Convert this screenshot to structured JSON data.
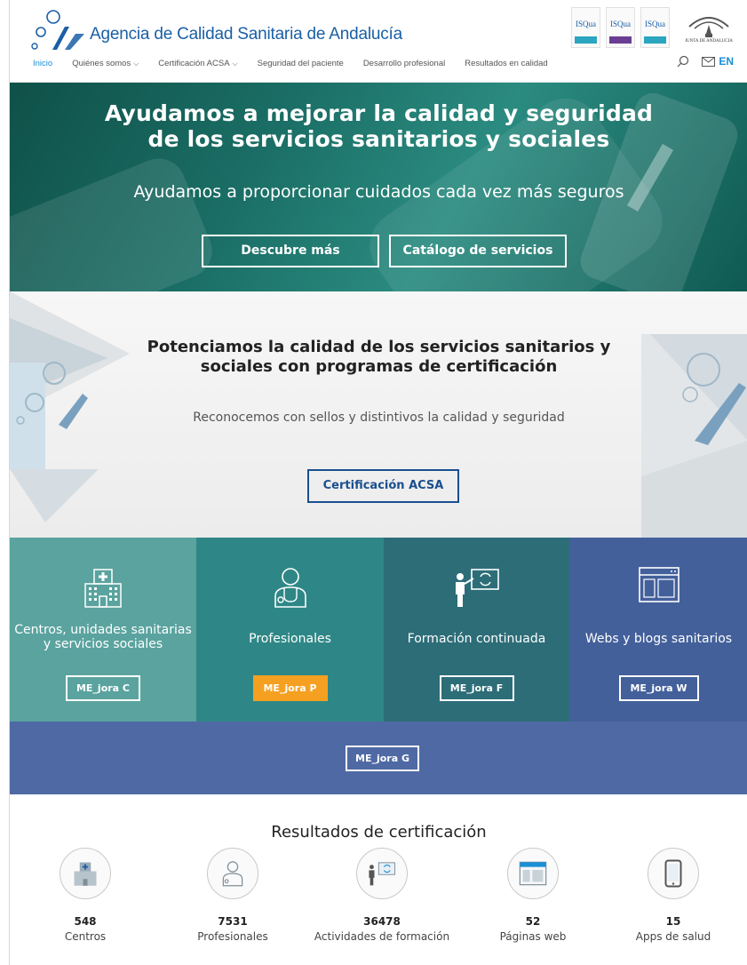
{
  "header": {
    "agency_name": "Agencia de Calidad Sanitaria de Andalucía",
    "badges": [
      {
        "text": "ISQua",
        "color": "#2aa6c0"
      },
      {
        "text": "ISQua",
        "color": "#6a3e93"
      },
      {
        "text": "ISQua",
        "color": "#2aa6c0"
      }
    ],
    "junta_text": "JUNTA DE ANDALUCIA"
  },
  "nav": {
    "items": [
      {
        "label": "Inicio",
        "active": true,
        "dropdown": false
      },
      {
        "label": "Quiénes somos",
        "active": false,
        "dropdown": true
      },
      {
        "label": "Certificación ACSA",
        "active": false,
        "dropdown": true
      },
      {
        "label": "Seguridad del paciente",
        "active": false,
        "dropdown": false
      },
      {
        "label": "Desarrollo profesional",
        "active": false,
        "dropdown": false
      },
      {
        "label": "Resultados en calidad",
        "active": false,
        "dropdown": false
      }
    ],
    "lang": "EN"
  },
  "hero": {
    "title_line1": "Ayudamos a mejorar la calidad y seguridad",
    "title_line2": "de los servicios sanitarios y sociales",
    "subtitle": "Ayudamos a proporcionar cuidados cada vez más seguros",
    "btn_discover": "Descubre más",
    "btn_catalog": "Catálogo de servicios"
  },
  "cert": {
    "title_line1": "Potenciamos la calidad de los servicios sanitarios y",
    "title_line2": "sociales con programas de certificación",
    "subtitle": "Reconocemos con sellos y distintivos la calidad y seguridad",
    "button": "Certificación ACSA"
  },
  "tiles": [
    {
      "label_line1": "Centros, unidades sanitarias",
      "label_line2": "y servicios sociales",
      "button": "ME_jora C",
      "icon": "hospital-icon",
      "color": "#5aa39f"
    },
    {
      "label_line1": "Profesionales",
      "label_line2": "",
      "button": "ME_jora P",
      "icon": "doctor-icon",
      "color": "#2e8786"
    },
    {
      "label_line1": "Formación continuada",
      "label_line2": "",
      "button": "ME_jora F",
      "icon": "teacher-icon",
      "color": "#2c6d78"
    },
    {
      "label_line1": "Webs y blogs sanitarios",
      "label_line2": "",
      "button": "ME_jora W",
      "icon": "browser-icon",
      "color": "#43609b"
    }
  ],
  "gband": {
    "button": "ME_jora G"
  },
  "results": {
    "title": "Resultados de certificación",
    "stats": [
      {
        "value": "548",
        "label": "Centros",
        "icon": "hospital-icon"
      },
      {
        "value": "7531",
        "label": "Profesionales",
        "icon": "doctor-icon"
      },
      {
        "value": "36478",
        "label": "Actividades de formación",
        "icon": "teacher-icon"
      },
      {
        "value": "52",
        "label": "Páginas web",
        "icon": "browser-icon"
      },
      {
        "value": "15",
        "label": "Apps de salud",
        "icon": "smartphone-icon"
      }
    ]
  }
}
